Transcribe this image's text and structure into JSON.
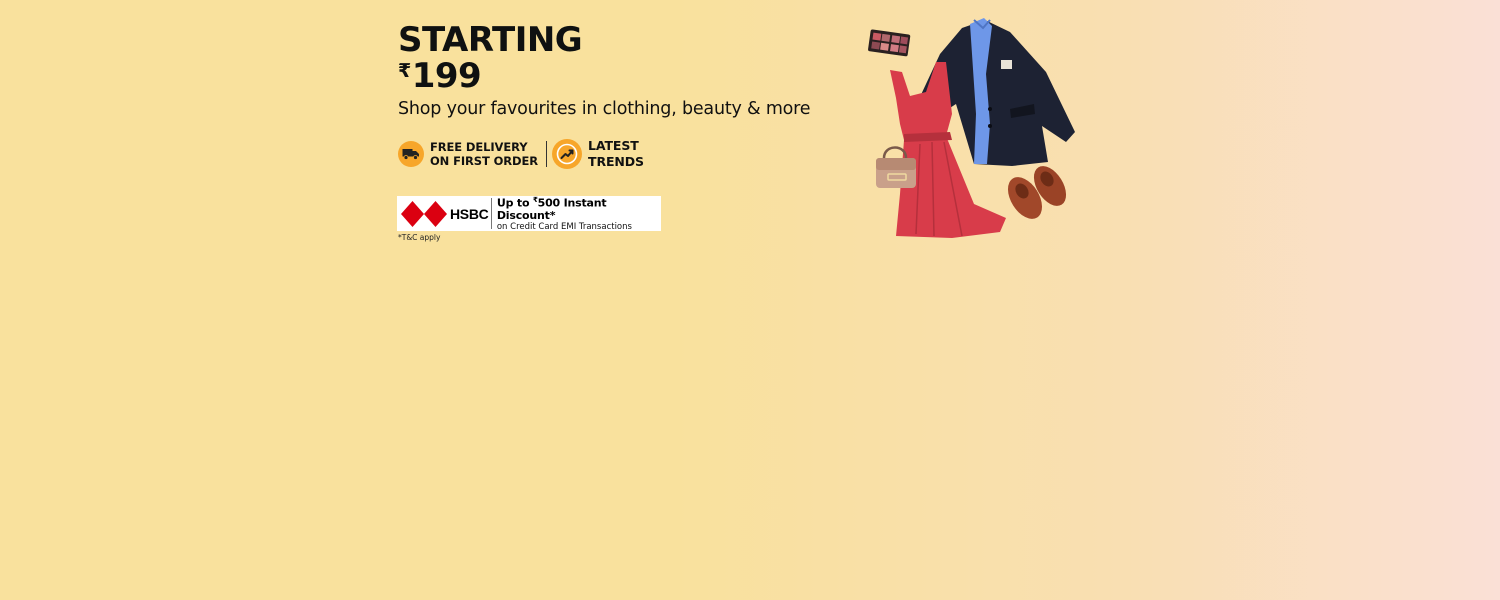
{
  "banner": {
    "headline_line1": "STARTING",
    "rupee_symbol": "₹",
    "price": "199",
    "subtitle": "Shop your favourites in clothing, beauty & more",
    "features": [
      {
        "icon": "delivery-truck-icon",
        "line1": "FREE DELIVERY",
        "line2": "ON FIRST ORDER"
      },
      {
        "icon": "trending-up-icon",
        "line1": "LATEST",
        "line2": "TRENDS"
      }
    ],
    "bank_offer": {
      "bank_name": "HSBC",
      "offer_prefix": "Up to ",
      "offer_rupee": "₹",
      "offer_amount_text": "500 Instant Discount*",
      "offer_sub": "on Credit Card EMI Transactions"
    },
    "tnc": "*T&C apply",
    "colors": {
      "background_left": "#f9e19d",
      "background_right": "#fae0d6",
      "icon_orange": "#f7a62a",
      "hsbc_red": "#db0011",
      "dress_red": "#d83c4a",
      "blazer_navy": "#1d2233",
      "shirt_blue": "#6e97e8",
      "shoes_brown": "#a1482a"
    },
    "product_image_items": [
      "eyeshadow-palette",
      "navy-blazer",
      "blue-shirt",
      "red-dress",
      "handbag",
      "loafers"
    ]
  }
}
